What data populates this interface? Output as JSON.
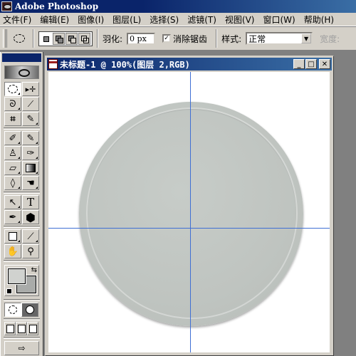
{
  "app": {
    "title": "Adobe Photoshop"
  },
  "menubar": {
    "items": [
      {
        "label": "文件(F)"
      },
      {
        "label": "编辑(E)"
      },
      {
        "label": "图像(I)"
      },
      {
        "label": "图层(L)"
      },
      {
        "label": "选择(S)"
      },
      {
        "label": "滤镜(T)"
      },
      {
        "label": "视图(V)"
      },
      {
        "label": "窗口(W)"
      },
      {
        "label": "帮助(H)"
      }
    ]
  },
  "options": {
    "tool": "elliptical-marquee",
    "selection_modes": [
      "new-selection",
      "add-to-selection",
      "subtract-from-selection",
      "intersect-with-selection"
    ],
    "active_mode": "new-selection",
    "feather_label": "羽化:",
    "feather_value": "0 px",
    "antialias_label": "消除锯齿",
    "antialias_checked": true,
    "antialias_mark": "✓",
    "style_label": "样式:",
    "style_value": "正常",
    "width_label": "宽度:"
  },
  "toolbox": {
    "tools": [
      {
        "name": "elliptical-marquee",
        "glyph": "◌",
        "active": true
      },
      {
        "name": "move",
        "glyph": "➤"
      },
      {
        "name": "lasso",
        "glyph": "ᘐ"
      },
      {
        "name": "magic-wand",
        "glyph": "⁄"
      },
      {
        "name": "crop",
        "glyph": "⌗"
      },
      {
        "name": "slice",
        "glyph": "✎"
      },
      {
        "name": "healing-brush",
        "glyph": "✐"
      },
      {
        "name": "brush",
        "glyph": "🖌"
      },
      {
        "name": "clone-stamp",
        "glyph": "♙"
      },
      {
        "name": "history-brush",
        "glyph": "✑"
      },
      {
        "name": "eraser",
        "glyph": "▱"
      },
      {
        "name": "gradient",
        "glyph": "▦"
      },
      {
        "name": "blur",
        "glyph": "💧"
      },
      {
        "name": "dodge",
        "glyph": "☚"
      },
      {
        "name": "path-selection",
        "glyph": "↖"
      },
      {
        "name": "type",
        "glyph": "T"
      },
      {
        "name": "pen",
        "glyph": "✒"
      },
      {
        "name": "custom-shape",
        "glyph": "⬢"
      },
      {
        "name": "notes",
        "glyph": "▢"
      },
      {
        "name": "eyedropper",
        "glyph": "⁄"
      },
      {
        "name": "hand",
        "glyph": "✋"
      },
      {
        "name": "zoom",
        "glyph": "🔍"
      }
    ],
    "foreground_color": "#d0d2cf",
    "background_color": "#a9aba9",
    "swap_glyph": "⇆",
    "jump_glyph": "⇨"
  },
  "document": {
    "title": "未标题-1 @ 100%(图层 2,RGB)",
    "minimize_glyph": "_",
    "maximize_glyph": "□",
    "close_glyph": "✕",
    "guide_color": "#3f6fd4"
  }
}
